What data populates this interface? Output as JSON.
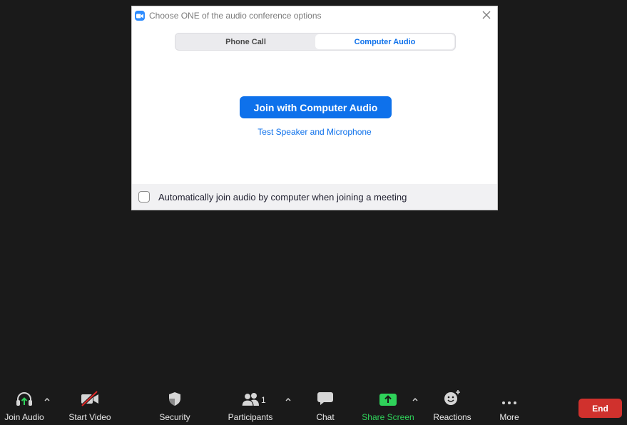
{
  "dialog": {
    "title": "Choose ONE of the audio conference options",
    "tabs": [
      {
        "label": "Phone Call",
        "active": false
      },
      {
        "label": "Computer Audio",
        "active": true
      }
    ],
    "join_button": "Join with Computer Audio",
    "test_link": "Test Speaker and Microphone",
    "auto_join_label": "Automatically join audio by computer when joining a meeting",
    "auto_join_checked": false
  },
  "toolbar": {
    "join_audio": "Join Audio",
    "start_video": "Start Video",
    "security": "Security",
    "participants": "Participants",
    "participant_count": "1",
    "chat": "Chat",
    "share_screen": "Share Screen",
    "reactions": "Reactions",
    "more": "More",
    "end": "End"
  },
  "colors": {
    "accent": "#0e71eb",
    "share_green": "#2fd25a",
    "end_red": "#d0312d",
    "background": "#1a1a1a"
  },
  "icons": {
    "app": "zoom-camera-icon",
    "close": "close-icon",
    "join_audio": "headphones-icon",
    "start_video": "video-off-icon",
    "security": "shield-icon",
    "participants": "people-icon",
    "chat": "chat-bubble-icon",
    "share_screen": "share-arrow-icon",
    "reactions": "smiley-plus-icon",
    "more": "ellipsis-icon",
    "caret": "chevron-up-icon"
  }
}
